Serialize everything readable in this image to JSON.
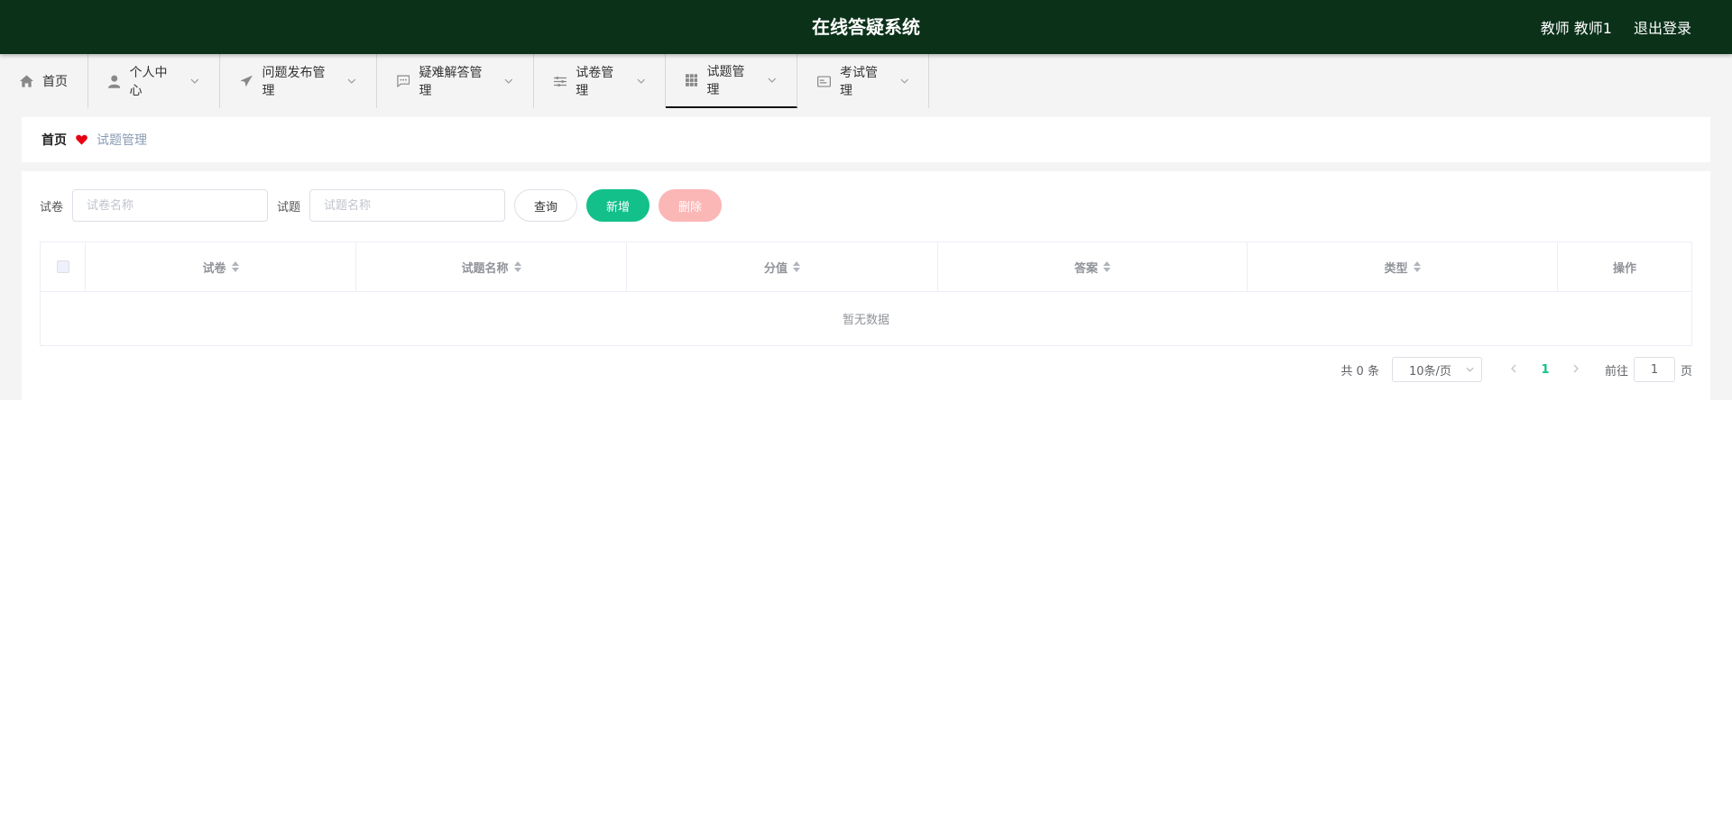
{
  "header": {
    "title": "在线答疑系统",
    "user": "教师 教师1",
    "logout": "退出登录"
  },
  "nav": {
    "items": [
      {
        "label": "首页",
        "icon": "home-icon"
      },
      {
        "label": "个人中心",
        "icon": "user-icon"
      },
      {
        "label": "问题发布管理",
        "icon": "send-icon"
      },
      {
        "label": "疑难解答管理",
        "icon": "chat-icon"
      },
      {
        "label": "试卷管理",
        "icon": "sliders-icon"
      },
      {
        "label": "试题管理",
        "icon": "grid-icon",
        "active": true
      },
      {
        "label": "考试管理",
        "icon": "id-card-icon"
      }
    ]
  },
  "breadcrumb": {
    "home": "首页",
    "current": "试题管理",
    "separator_color": "#e60012"
  },
  "search": {
    "paper_label": "试卷",
    "paper_placeholder": "试卷名称",
    "question_label": "试题",
    "question_placeholder": "试题名称",
    "query_btn": "查询",
    "add_btn": "新增",
    "delete_btn": "删除"
  },
  "table": {
    "columns": [
      "试卷",
      "试题名称",
      "分值",
      "答案",
      "类型",
      "操作"
    ],
    "empty_text": "暂无数据"
  },
  "pagination": {
    "total": "共 0 条",
    "page_size": "10条/页",
    "current_page": "1",
    "goto_label": "前往",
    "goto_value": "1",
    "goto_suffix": "页"
  },
  "colors": {
    "header_bg": "#0b3119",
    "primary": "#13c08a",
    "danger_light": "#fbb6b6"
  }
}
